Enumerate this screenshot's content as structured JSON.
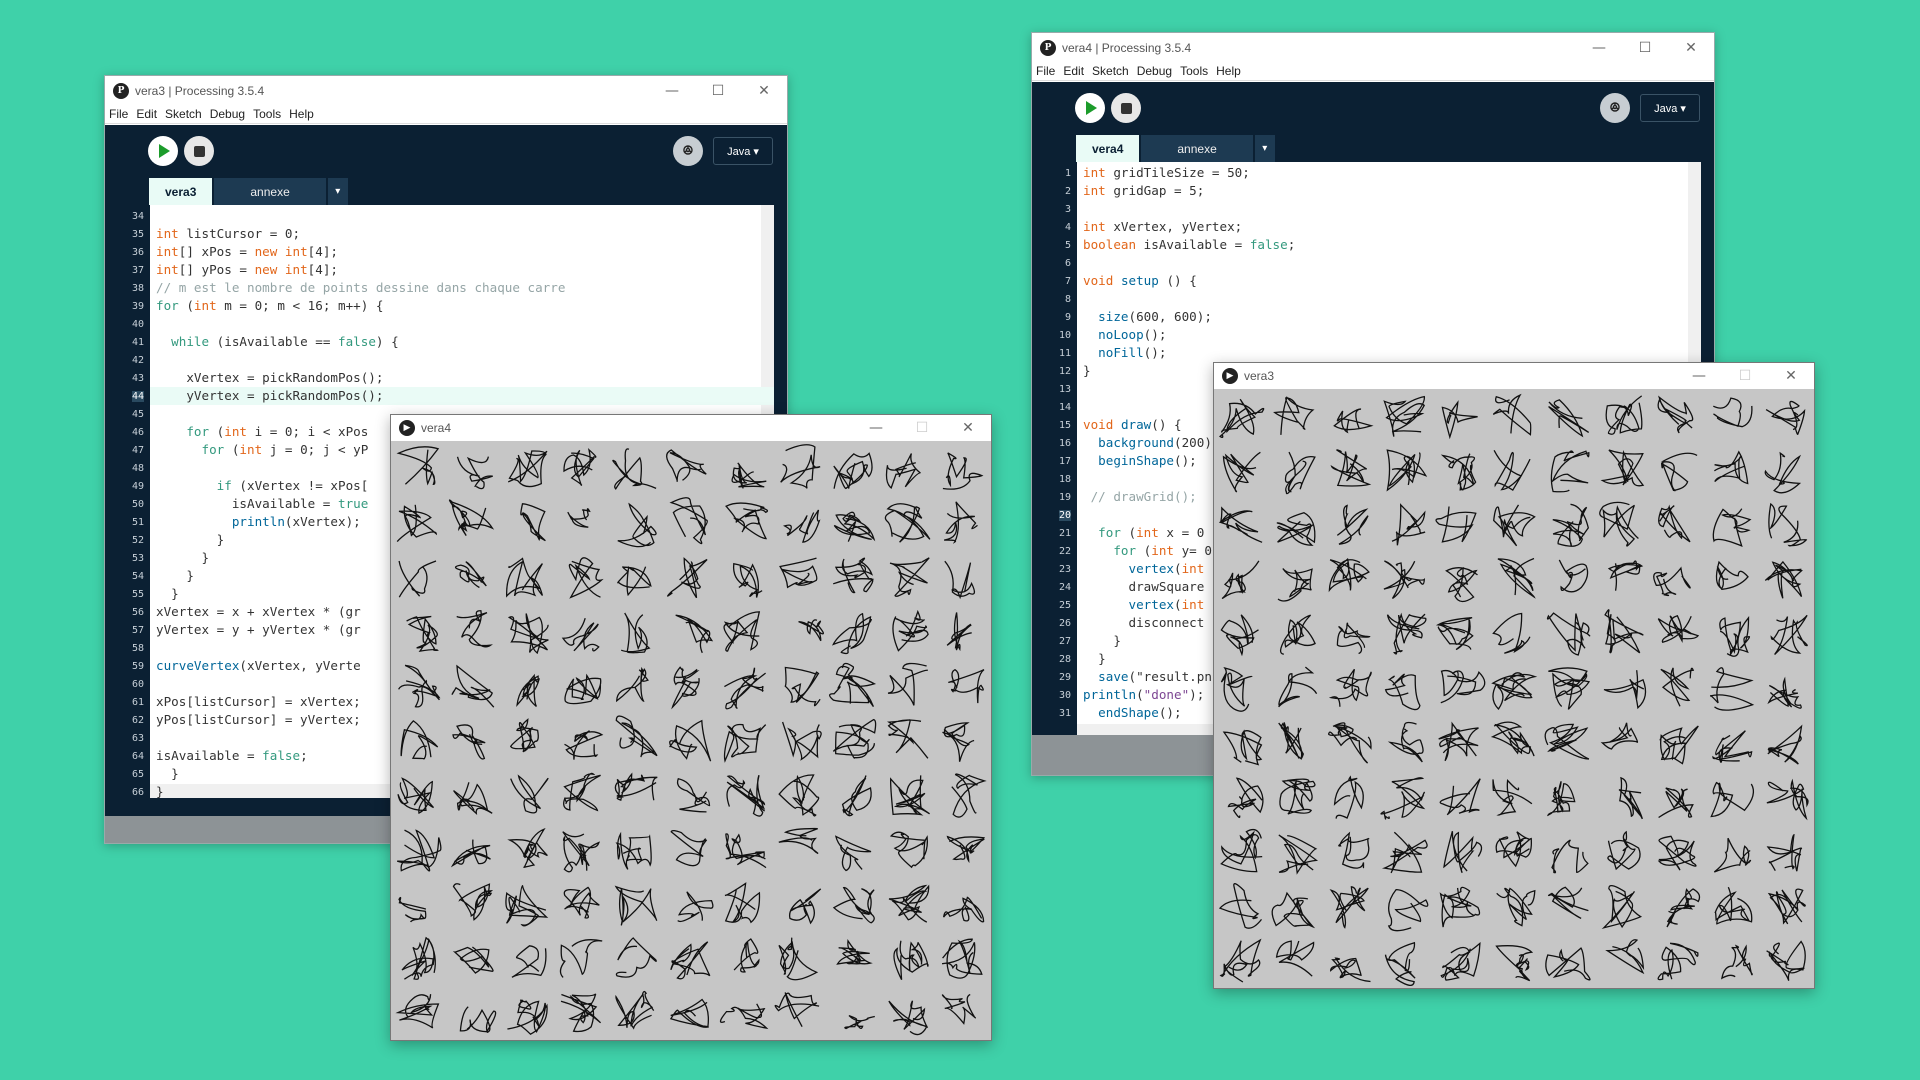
{
  "windows": {
    "ide_left": {
      "title": "vera3 | Processing 3.5.4",
      "menu": [
        "File",
        "Edit",
        "Sketch",
        "Debug",
        "Tools",
        "Help"
      ],
      "mode": "Java ▾",
      "tabs": [
        "vera3",
        "annexe"
      ],
      "tab_menu": "▾",
      "current_line": 44,
      "lines": [
        {
          "n": "34",
          "code": ""
        },
        {
          "n": "35",
          "code": "int listCursor = 0;"
        },
        {
          "n": "36",
          "code": "int[] xPos = new int[4];"
        },
        {
          "n": "37",
          "code": "int[] yPos = new int[4];"
        },
        {
          "n": "38",
          "code": "// m est le nombre de points dessine dans chaque carre"
        },
        {
          "n": "39",
          "code": "for (int m = 0; m < 16; m++) {"
        },
        {
          "n": "40",
          "code": ""
        },
        {
          "n": "41",
          "code": "  while (isAvailable == false) {"
        },
        {
          "n": "42",
          "code": ""
        },
        {
          "n": "43",
          "code": "    xVertex = pickRandomPos();"
        },
        {
          "n": "44",
          "code": "    yVertex = pickRandomPos();"
        },
        {
          "n": "45",
          "code": ""
        },
        {
          "n": "46",
          "code": "    for (int i = 0; i < xPos"
        },
        {
          "n": "47",
          "code": "      for (int j = 0; j < yP"
        },
        {
          "n": "48",
          "code": ""
        },
        {
          "n": "49",
          "code": "        if (xVertex != xPos["
        },
        {
          "n": "50",
          "code": "          isAvailable = true"
        },
        {
          "n": "51",
          "code": "          println(xVertex);"
        },
        {
          "n": "52",
          "code": "        }"
        },
        {
          "n": "53",
          "code": "      }"
        },
        {
          "n": "54",
          "code": "    }"
        },
        {
          "n": "55",
          "code": "  }"
        },
        {
          "n": "56",
          "code": "xVertex = x + xVertex * (gr"
        },
        {
          "n": "57",
          "code": "yVertex = y + yVertex * (gr"
        },
        {
          "n": "58",
          "code": ""
        },
        {
          "n": "59",
          "code": "curveVertex(xVertex, yVerte"
        },
        {
          "n": "60",
          "code": ""
        },
        {
          "n": "61",
          "code": "xPos[listCursor] = xVertex;"
        },
        {
          "n": "62",
          "code": "yPos[listCursor] = yVertex;"
        },
        {
          "n": "63",
          "code": ""
        },
        {
          "n": "64",
          "code": "isAvailable = false;"
        },
        {
          "n": "65",
          "code": "  }"
        },
        {
          "n": "66",
          "code": "}"
        }
      ]
    },
    "ide_right": {
      "title": "vera4 | Processing 3.5.4",
      "menu": [
        "File",
        "Edit",
        "Sketch",
        "Debug",
        "Tools",
        "Help"
      ],
      "mode": "Java ▾",
      "tabs": [
        "vera4",
        "annexe"
      ],
      "tab_menu": "▾",
      "current_line": 20,
      "lines": [
        {
          "n": "1",
          "code": "int gridTileSize = 50;"
        },
        {
          "n": "2",
          "code": "int gridGap = 5;"
        },
        {
          "n": "3",
          "code": ""
        },
        {
          "n": "4",
          "code": "int xVertex, yVertex;"
        },
        {
          "n": "5",
          "code": "boolean isAvailable = false;"
        },
        {
          "n": "6",
          "code": ""
        },
        {
          "n": "7",
          "code": "void setup () {"
        },
        {
          "n": "8",
          "code": ""
        },
        {
          "n": "9",
          "code": "  size(600, 600);"
        },
        {
          "n": "10",
          "code": "  noLoop();"
        },
        {
          "n": "11",
          "code": "  noFill();"
        },
        {
          "n": "12",
          "code": "}"
        },
        {
          "n": "13",
          "code": ""
        },
        {
          "n": "14",
          "code": ""
        },
        {
          "n": "15",
          "code": "void draw() {"
        },
        {
          "n": "16",
          "code": "  background(200)"
        },
        {
          "n": "17",
          "code": "  beginShape();"
        },
        {
          "n": "18",
          "code": ""
        },
        {
          "n": "19",
          "code": " // drawGrid();"
        },
        {
          "n": "20",
          "code": ""
        },
        {
          "n": "21",
          "code": "  for (int x = 0"
        },
        {
          "n": "22",
          "code": "    for (int y= 0"
        },
        {
          "n": "23",
          "code": "      vertex(int"
        },
        {
          "n": "24",
          "code": "      drawSquare"
        },
        {
          "n": "25",
          "code": "      vertex(int"
        },
        {
          "n": "26",
          "code": "      disconnect"
        },
        {
          "n": "27",
          "code": "    }"
        },
        {
          "n": "28",
          "code": "  }"
        },
        {
          "n": "29",
          "code": "  save(\"result.pn"
        },
        {
          "n": "30",
          "code": "println(\"done\");"
        },
        {
          "n": "31",
          "code": "  endShape();"
        }
      ]
    },
    "sketch_vera4": {
      "title": "vera4",
      "seed": 4
    },
    "sketch_vera3": {
      "title": "vera3",
      "seed": 3
    }
  },
  "icons": {
    "app": "processing-logo-icon",
    "run": "play-icon",
    "stop": "stop-icon",
    "debug": "butterfly-debug-icon"
  },
  "colors": {
    "background": "#3fd1a9",
    "ide_dark": "#0b2033",
    "sketch_bg": "#c6c6c6",
    "run_green": "#1c9c2b"
  }
}
